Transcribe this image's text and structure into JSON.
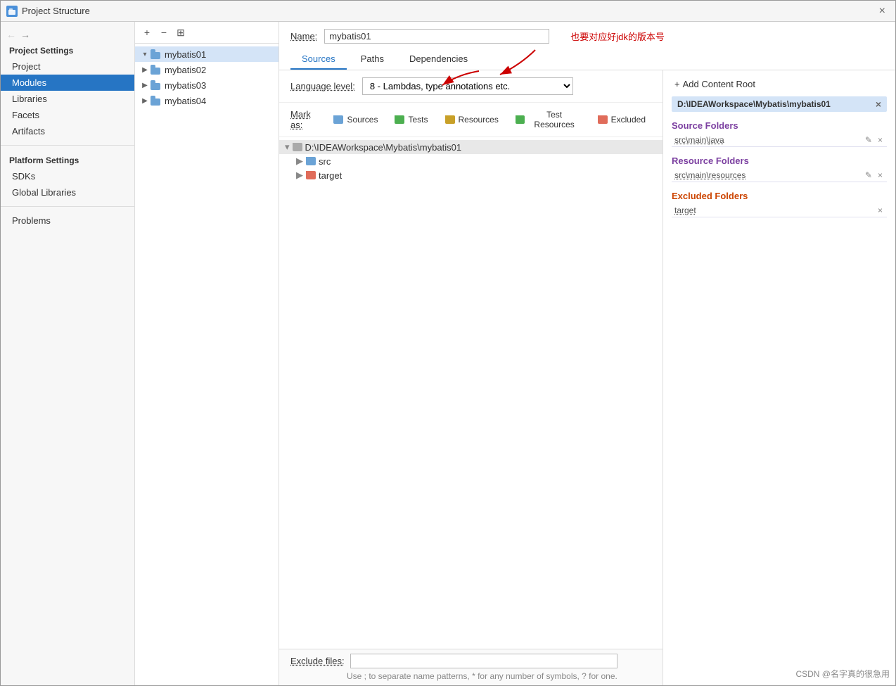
{
  "window": {
    "title": "Project Structure",
    "close_label": "×"
  },
  "nav": {
    "back_label": "←",
    "forward_label": "→"
  },
  "sidebar": {
    "project_settings_title": "Project Settings",
    "platform_settings_title": "Platform Settings",
    "items": [
      {
        "id": "project",
        "label": "Project"
      },
      {
        "id": "modules",
        "label": "Modules",
        "active": true
      },
      {
        "id": "libraries",
        "label": "Libraries"
      },
      {
        "id": "facets",
        "label": "Facets"
      },
      {
        "id": "artifacts",
        "label": "Artifacts"
      },
      {
        "id": "sdks",
        "label": "SDKs"
      },
      {
        "id": "global-libraries",
        "label": "Global Libraries"
      },
      {
        "id": "problems",
        "label": "Problems"
      }
    ]
  },
  "module_toolbar": {
    "add_label": "+",
    "remove_label": "−",
    "copy_label": "⊞"
  },
  "modules": [
    {
      "id": "mybatis01",
      "label": "mybatis01",
      "selected": true
    },
    {
      "id": "mybatis02",
      "label": "mybatis02"
    },
    {
      "id": "mybatis03",
      "label": "mybatis03"
    },
    {
      "id": "mybatis04",
      "label": "mybatis04"
    }
  ],
  "content": {
    "name_label": "Name:",
    "name_value": "mybatis01",
    "annotation": "也要对应好jdk的版本号",
    "tabs": [
      {
        "id": "sources",
        "label": "Sources",
        "active": true
      },
      {
        "id": "paths",
        "label": "Paths"
      },
      {
        "id": "dependencies",
        "label": "Dependencies"
      }
    ],
    "language_level_label": "Language level:",
    "language_level_value": "8 - Lambdas, type annotations etc.",
    "mark_as_label": "Mark as:",
    "mark_as_buttons": [
      {
        "id": "sources",
        "label": "Sources",
        "color": "#6ba3d6"
      },
      {
        "id": "tests",
        "label": "Tests",
        "color": "#4caf50"
      },
      {
        "id": "resources",
        "label": "Resources",
        "color": "#c8a028"
      },
      {
        "id": "test-resources",
        "label": "Test Resources",
        "color": "#4caf50"
      },
      {
        "id": "excluded",
        "label": "Excluded",
        "color": "#e06c5a"
      }
    ],
    "file_tree": {
      "root": "D:\\IDEAWorkspace\\Mybatis\\mybatis01",
      "children": [
        {
          "id": "src",
          "label": "src",
          "type": "folder"
        },
        {
          "id": "target",
          "label": "target",
          "type": "folder"
        }
      ]
    },
    "exclude_files_label": "Exclude files:",
    "exclude_files_value": "",
    "exclude_hint": "Use ; to separate name patterns, * for any number of symbols, ? for one."
  },
  "right_panel": {
    "add_content_root_label": "+ Add Content Root",
    "content_root_path": "D:\\IDEAWorkspace\\Mybatis\\mybatis01",
    "source_folders_title": "Source Folders",
    "source_folders": [
      {
        "path": "src\\main\\java"
      }
    ],
    "resource_folders_title": "Resource Folders",
    "resource_folders": [
      {
        "path": "src\\main\\resources"
      }
    ],
    "excluded_folders_title": "Excluded Folders",
    "excluded_folders": [
      {
        "path": "target"
      }
    ]
  },
  "watermark": "CSDN @名字真的很急用"
}
